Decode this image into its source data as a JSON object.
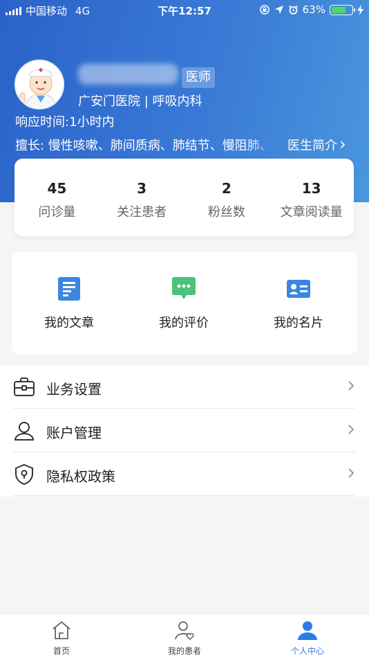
{
  "status_bar": {
    "carrier": "中国移动",
    "network": "4G",
    "time": "下午12:57",
    "battery_percent": "63%",
    "battery_level": 0.63
  },
  "profile": {
    "role_tag": "医师",
    "hospital_department": "广安门医院 | 呼吸内科",
    "response_time": "响应时间:1小时内",
    "specialty": "擅长: 慢性咳嗽、肺间质病、肺结节、慢阻肺、",
    "intro_link": "医生简介"
  },
  "stats": [
    {
      "value": "45",
      "label": "问诊量"
    },
    {
      "value": "3",
      "label": "关注患者"
    },
    {
      "value": "2",
      "label": "粉丝数"
    },
    {
      "value": "13",
      "label": "文章阅读量"
    }
  ],
  "actions": [
    {
      "label": "我的文章",
      "icon": "article-icon"
    },
    {
      "label": "我的评价",
      "icon": "review-icon"
    },
    {
      "label": "我的名片",
      "icon": "business-card-icon"
    }
  ],
  "menu": [
    {
      "label": "业务设置",
      "icon": "briefcase-icon"
    },
    {
      "label": "账户管理",
      "icon": "user-icon"
    },
    {
      "label": "隐私权政策",
      "icon": "shield-icon"
    }
  ],
  "tabbar": [
    {
      "label": "首页",
      "icon": "home-icon",
      "active": false
    },
    {
      "label": "我的患者",
      "icon": "patient-icon",
      "active": false
    },
    {
      "label": "个人中心",
      "icon": "profile-icon",
      "active": true
    }
  ],
  "colors": {
    "header_start": "#2a62c9",
    "header_end": "#4a97dc",
    "accent": "#2d7be5",
    "article_icon": "#3b86e0",
    "review_icon": "#4cc27a",
    "card_icon": "#3b86e0"
  }
}
